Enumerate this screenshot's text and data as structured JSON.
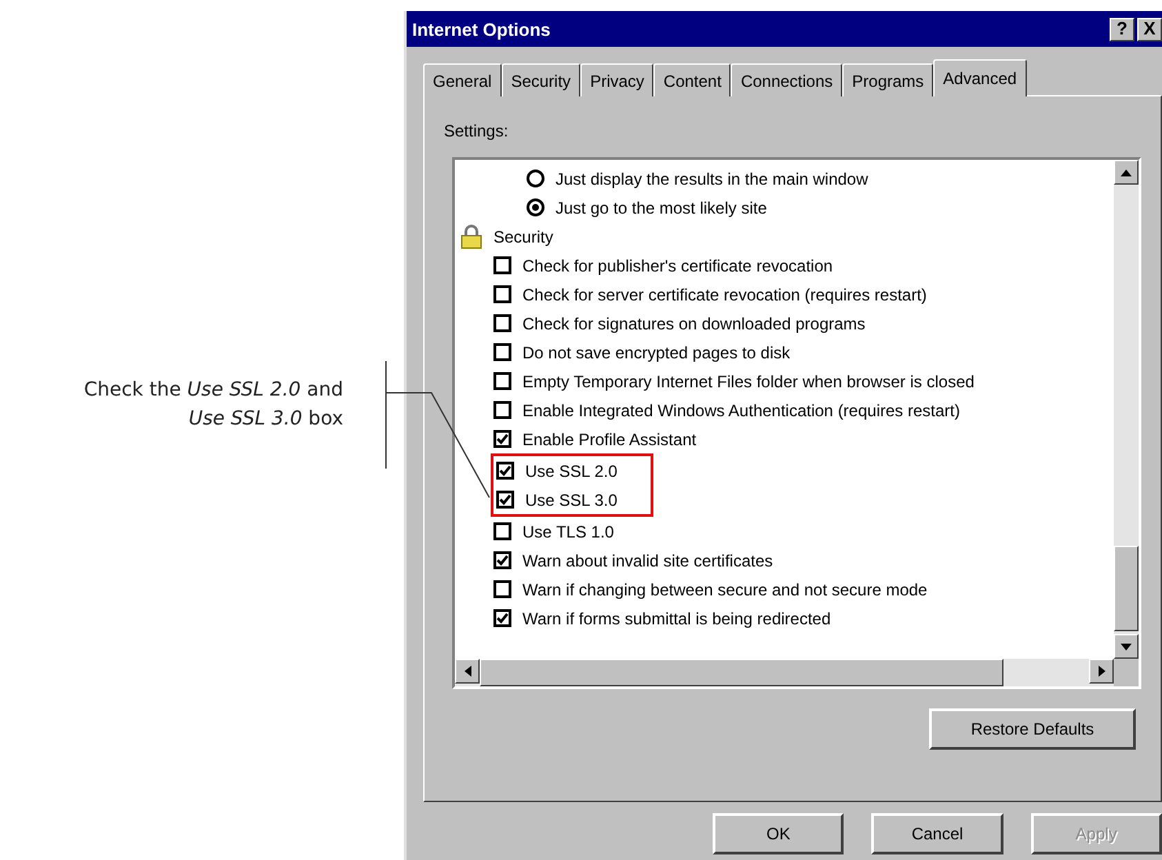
{
  "annotation": {
    "text": "Check the *Use SSL 2.0* and *Use SSL 3.0* box"
  },
  "window": {
    "title": "Internet Options",
    "help": "?",
    "close": "X"
  },
  "tabs": [
    {
      "label": "General",
      "selected": false
    },
    {
      "label": "Security",
      "selected": false
    },
    {
      "label": "Privacy",
      "selected": false
    },
    {
      "label": "Content",
      "selected": false
    },
    {
      "label": "Connections",
      "selected": false
    },
    {
      "label": "Programs",
      "selected": false
    },
    {
      "label": "Advanced",
      "selected": true
    }
  ],
  "settings_label": "Settings:",
  "settings": [
    {
      "kind": "radio",
      "label": "Just display the results in the main window",
      "selected": false
    },
    {
      "kind": "radio",
      "label": "Just go to the most likely site",
      "selected": true
    },
    {
      "kind": "group",
      "label": "Security",
      "children": [
        {
          "kind": "checkbox",
          "label": "Check for publisher's certificate revocation",
          "checked": false,
          "highlighted": false
        },
        {
          "kind": "checkbox",
          "label": "Check for server certificate revocation (requires restart)",
          "checked": false,
          "highlighted": false
        },
        {
          "kind": "checkbox",
          "label": "Check for signatures on downloaded programs",
          "checked": false,
          "highlighted": false
        },
        {
          "kind": "checkbox",
          "label": "Do not save encrypted pages to disk",
          "checked": false,
          "highlighted": false
        },
        {
          "kind": "checkbox",
          "label": "Empty Temporary Internet Files folder when browser is closed",
          "checked": false,
          "highlighted": false
        },
        {
          "kind": "checkbox",
          "label": "Enable Integrated Windows Authentication (requires restart)",
          "checked": false,
          "highlighted": false
        },
        {
          "kind": "checkbox",
          "label": "Enable Profile Assistant",
          "checked": true,
          "highlighted": false
        },
        {
          "kind": "checkbox",
          "label": "Use SSL 2.0",
          "checked": true,
          "highlighted": true
        },
        {
          "kind": "checkbox",
          "label": "Use SSL 3.0",
          "checked": true,
          "highlighted": true
        },
        {
          "kind": "checkbox",
          "label": "Use TLS 1.0",
          "checked": false,
          "highlighted": false
        },
        {
          "kind": "checkbox",
          "label": "Warn about invalid site certificates",
          "checked": true,
          "highlighted": false
        },
        {
          "kind": "checkbox",
          "label": "Warn if changing between secure and not secure mode",
          "checked": false,
          "highlighted": false
        },
        {
          "kind": "checkbox",
          "label": "Warn if forms submittal is being redirected",
          "checked": true,
          "highlighted": false
        }
      ]
    }
  ],
  "restore_button": "Restore Defaults",
  "buttons": [
    {
      "label": "OK",
      "disabled": false
    },
    {
      "label": "Cancel",
      "disabled": false
    },
    {
      "label": "Apply",
      "disabled": true
    }
  ]
}
